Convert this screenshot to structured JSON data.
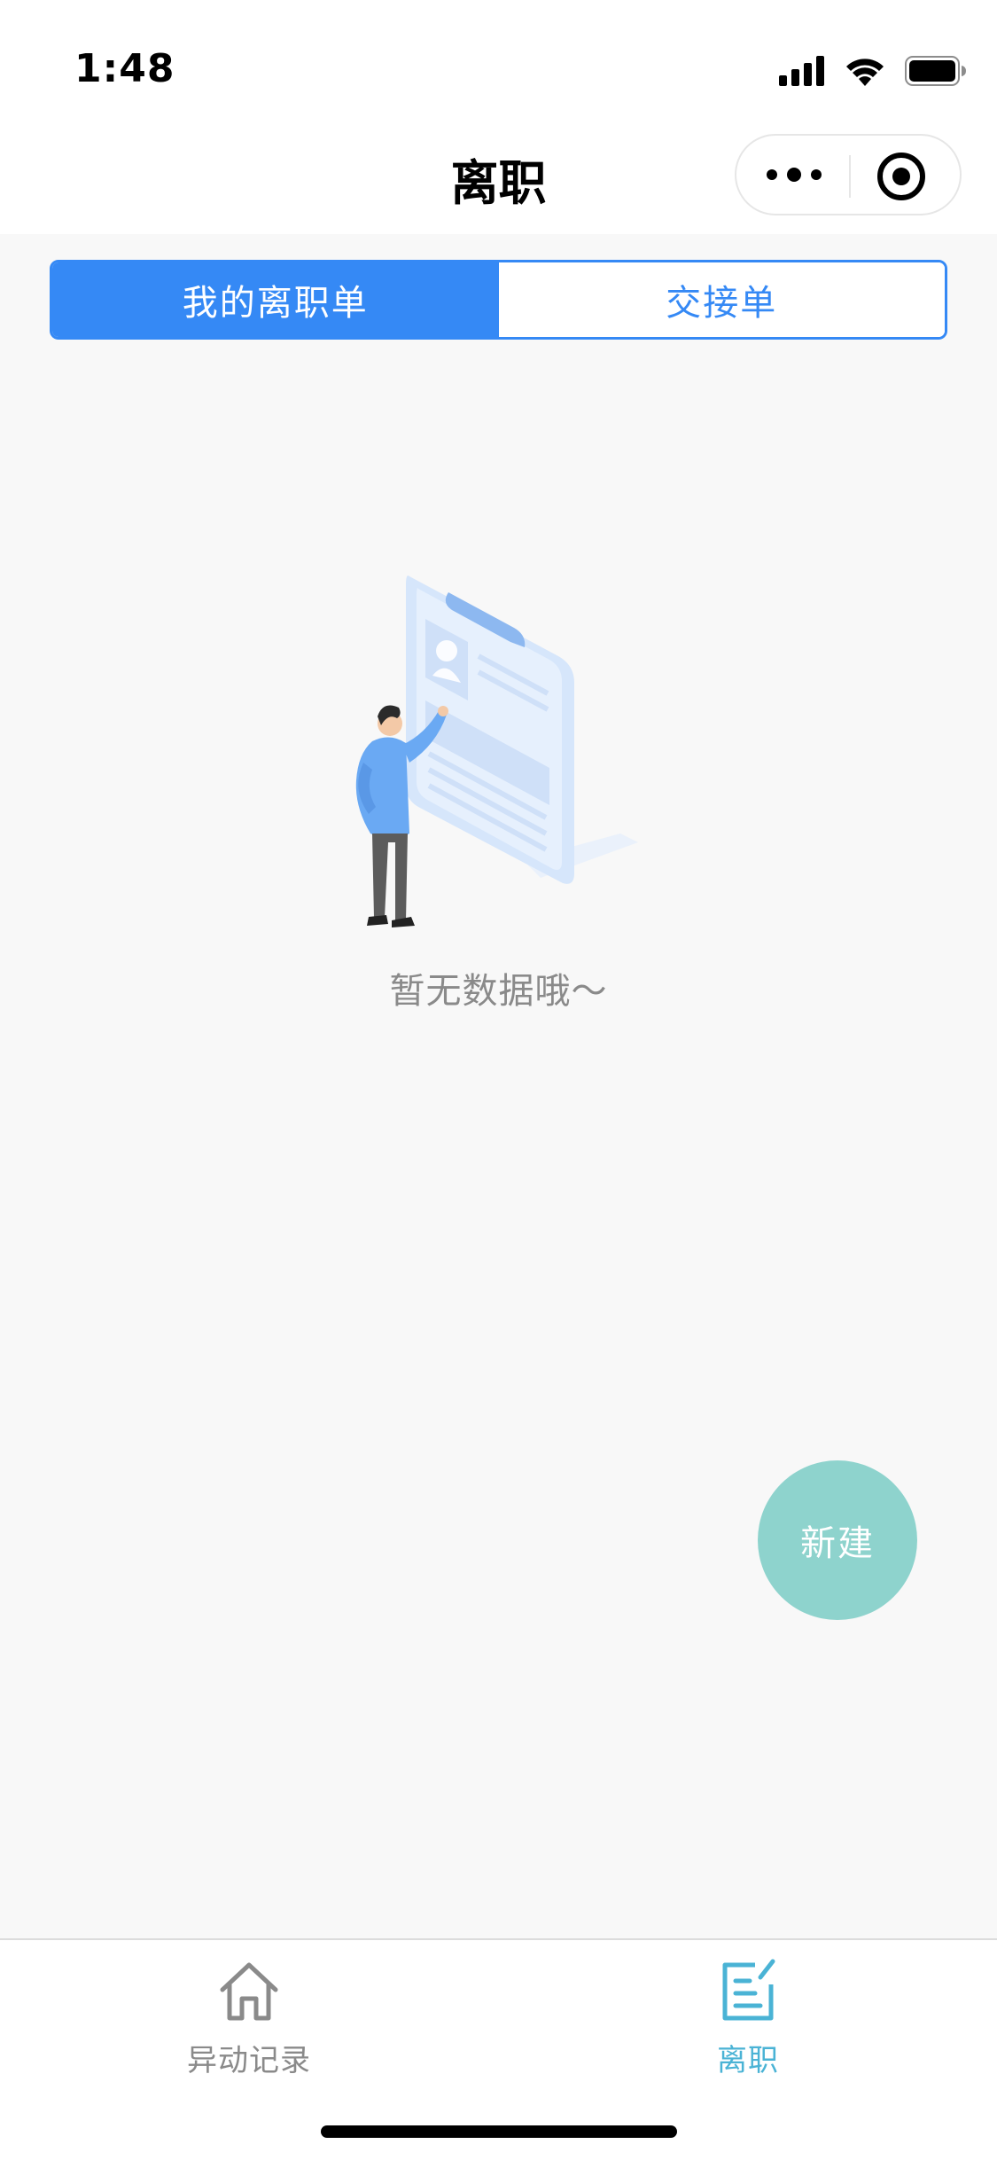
{
  "status_bar": {
    "time": "1:48",
    "icons": [
      "signal-icon",
      "wifi-icon",
      "battery-icon"
    ]
  },
  "nav": {
    "title": "离职",
    "capsule_icons": [
      "more-icon",
      "target-icon"
    ]
  },
  "tabs": {
    "items": [
      {
        "label": "我的离职单",
        "active": true
      },
      {
        "label": "交接单",
        "active": false
      }
    ],
    "accent_color": "#3589f5"
  },
  "empty_state": {
    "message": "暂无数据哦～",
    "illustration": "empty-clipboard-illustration"
  },
  "fab": {
    "label": "新建",
    "color": "#8ed3cd"
  },
  "tab_bar": {
    "items": [
      {
        "label": "异动记录",
        "icon": "home-icon",
        "active": false
      },
      {
        "label": "离职",
        "icon": "edit-document-icon",
        "active": true
      }
    ],
    "active_color": "#4ab3d5"
  }
}
